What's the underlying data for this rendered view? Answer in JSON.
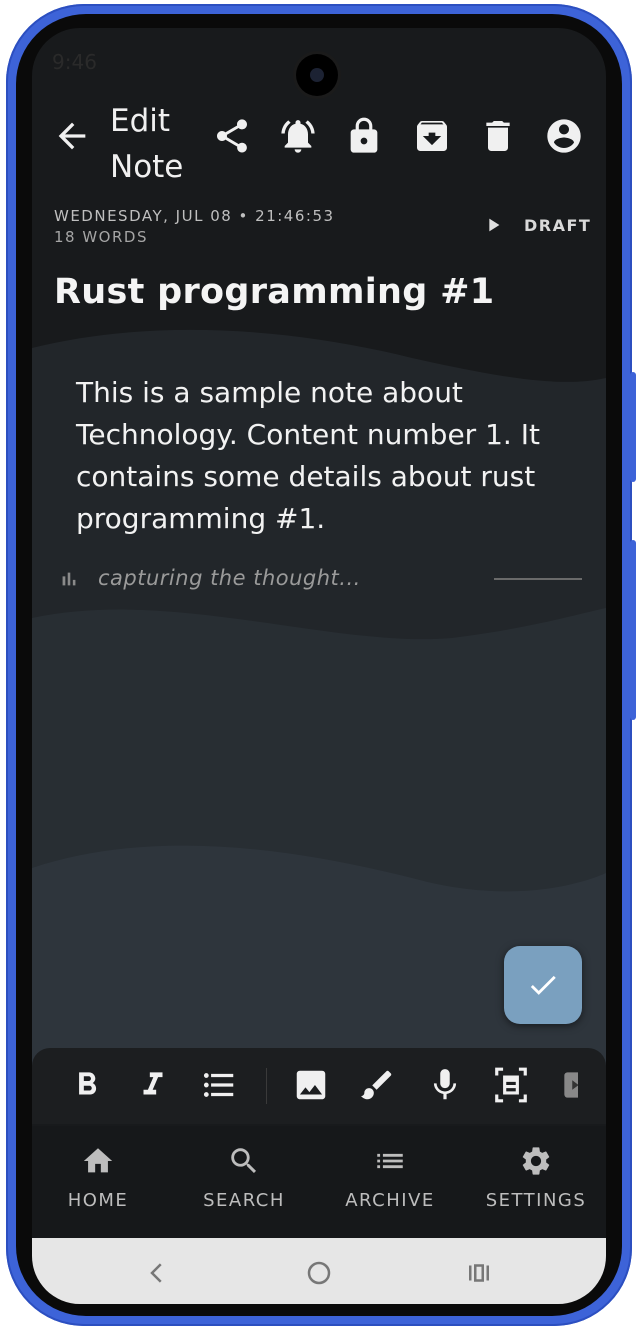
{
  "statusbar": {
    "time": "9:46"
  },
  "header": {
    "title": "Edit Note",
    "icons": [
      "back-arrow-icon",
      "share-icon",
      "alarm-icon",
      "lock-icon",
      "archive-icon",
      "trash-icon",
      "account-icon"
    ]
  },
  "note": {
    "date": "WEDNESDAY, JUL 08 • 21:46:53",
    "words": "18 WORDS",
    "status": "DRAFT",
    "title": "Rust programming #1",
    "content": "This is a sample note about Technology. Content number 1. It contains some details about rust programming #1.",
    "capture_placeholder": "capturing the thought..."
  },
  "format_bar": {
    "buttons": [
      "bold",
      "italic",
      "bulleted-list",
      "image",
      "brush",
      "microphone",
      "scan",
      "more"
    ]
  },
  "bottom_nav": {
    "items": [
      {
        "label": "HOME",
        "icon": "home-icon"
      },
      {
        "label": "SEARCH",
        "icon": "search-icon"
      },
      {
        "label": "ARCHIVE",
        "icon": "list-icon"
      },
      {
        "label": "SETTINGS",
        "icon": "gear-icon"
      }
    ]
  },
  "colors": {
    "frame": "#3d63d8",
    "background": "#181a1c",
    "fab": "#7aa0bf",
    "wave1": "#23272b",
    "wave2": "#2a3036",
    "wave3": "#303840"
  }
}
